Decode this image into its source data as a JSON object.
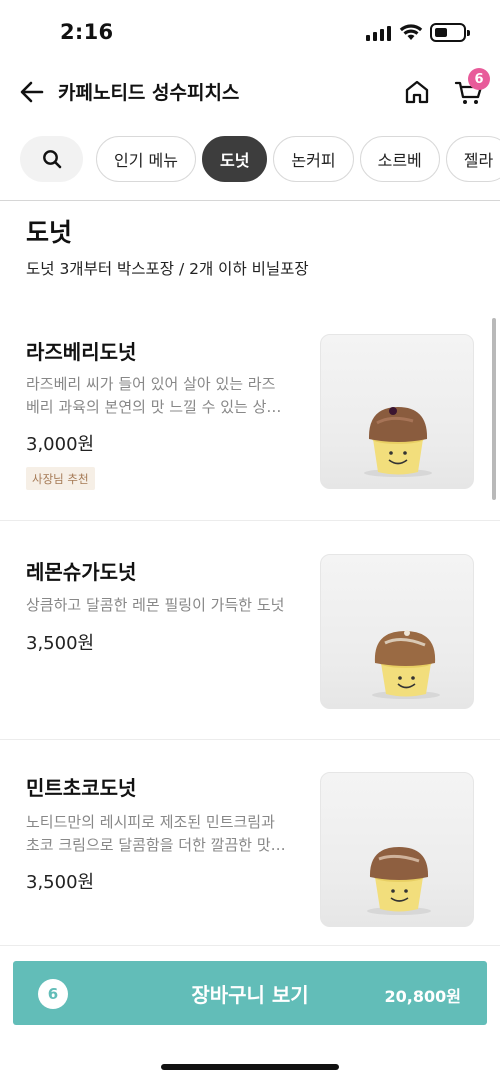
{
  "status_bar": {
    "time": "2:16",
    "battery_level": 0.45
  },
  "nav": {
    "title": "카페노티드 성수피치스",
    "cart_badge": "6",
    "icons": {
      "back": "back-arrow-icon",
      "home": "home-icon",
      "cart": "cart-icon"
    }
  },
  "tabs": {
    "search_icon": "search-icon",
    "items": [
      {
        "label": "인기 메뉴",
        "active": false
      },
      {
        "label": "도넛",
        "active": true
      },
      {
        "label": "논커피",
        "active": false
      },
      {
        "label": "소르베",
        "active": false
      },
      {
        "label": "젤라",
        "active": false
      }
    ]
  },
  "section": {
    "title": "도넛",
    "subtitle": "도넛 3개부터 박스포장 / 2개 이하 비닐포장"
  },
  "menu_items": [
    {
      "name": "라즈베리도넛",
      "desc_line1": "라즈베리 씨가 들어 있어 살아 있는 라즈",
      "desc_line2": "베리 과육의 본연의 맛 느낄 수 있는 상…",
      "price": "3,000원",
      "badge": "사장님 추천"
    },
    {
      "name": "레몬슈가도넛",
      "desc_line1": "상큼하고 달콤한 레몬 필링이 가득한 도넛",
      "desc_line2": "",
      "price": "3,500원",
      "badge": ""
    },
    {
      "name": "민트초코도넛",
      "desc_line1": "노티드만의 레시피로 제조된 민트크림과",
      "desc_line2": "초코 크림으로 달콤함을 더한 깔끔한 맛…",
      "price": "3,500원",
      "badge": ""
    }
  ],
  "cart_bar": {
    "count": "6",
    "label": "장바구니 보기",
    "total": "20,800원"
  },
  "colors": {
    "accent": "#62bdb8",
    "badge_pink": "#e85b9a",
    "active_chip": "#3d3d3d"
  }
}
